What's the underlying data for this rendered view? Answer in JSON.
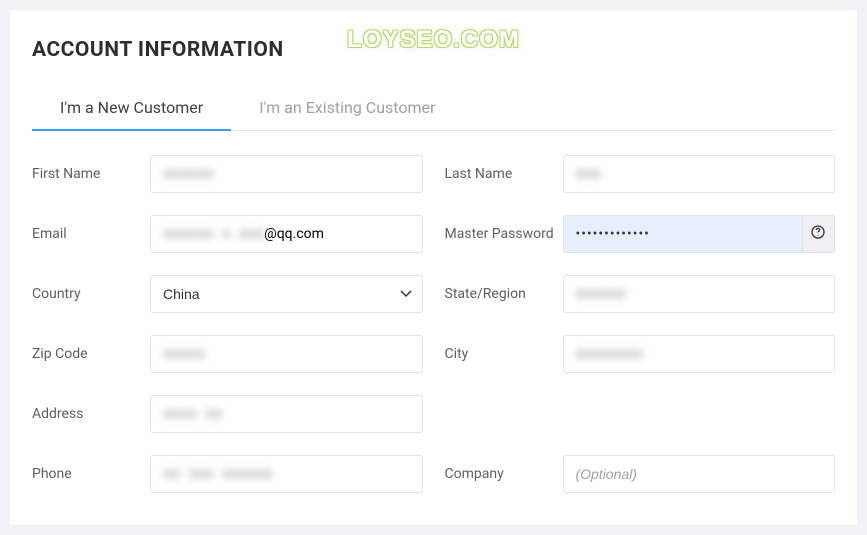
{
  "watermark": "LOYSEO.COM",
  "section_title": "ACCOUNT INFORMATION",
  "tabs": {
    "new": "I'm a New Customer",
    "existing": "I'm an Existing Customer"
  },
  "labels": {
    "first_name": "First Name",
    "last_name": "Last Name",
    "email": "Email",
    "master_password": "Master Password",
    "country": "Country",
    "state_region": "State/Region",
    "zip_code": "Zip Code",
    "city": "City",
    "address": "Address",
    "phone": "Phone",
    "company": "Company"
  },
  "values": {
    "first_name": "xxxxxx",
    "last_name": "xxx",
    "email_suffix": "@qq.com",
    "email_blur": "xxxxxx x xxx",
    "master_password": "•••••••••••••",
    "country": "China",
    "state_blur": "xxxxxx",
    "zip_blur": "xxxxx",
    "city_blur": "xxxxxxxx",
    "address_blur": "xxxx xx",
    "phone_blur": "xx xxx xxxxxx"
  },
  "placeholders": {
    "company": "(Optional)"
  }
}
